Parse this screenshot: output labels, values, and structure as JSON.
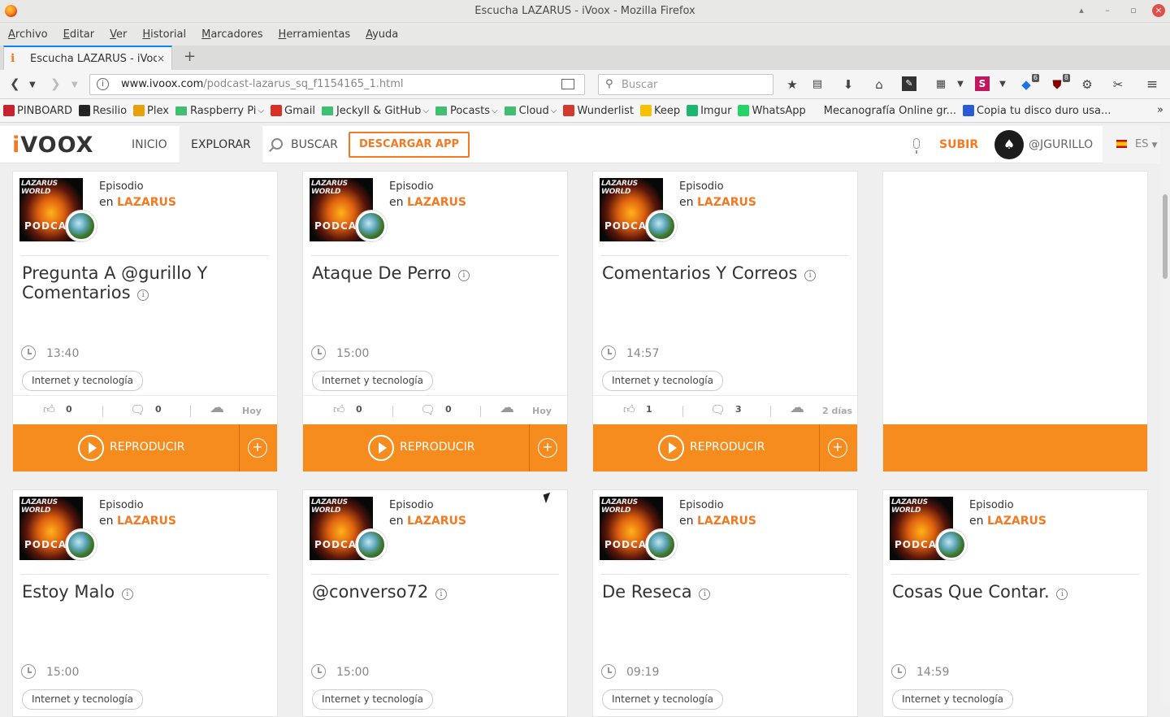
{
  "window": {
    "title": "Escucha LAZARUS - iVoox - Mozilla Firefox"
  },
  "menubar": [
    "Archivo",
    "Editar",
    "Ver",
    "Historial",
    "Marcadores",
    "Herramientas",
    "Ayuda"
  ],
  "tab": {
    "title": "Escucha LAZARUS - iVoox",
    "close": "×",
    "new_tab": "+"
  },
  "navbar": {
    "url_host": "www.ivoox.com",
    "url_path": "/podcast-lazarus_sq_f1154165_1.html",
    "search_placeholder": "Buscar",
    "badges": {
      "notifications": "6",
      "ublock": "8"
    }
  },
  "bookmarks": [
    {
      "label": "PINBOARD",
      "type": "icon",
      "color": "#c8202f"
    },
    {
      "label": "Resilio",
      "type": "icon",
      "color": "#222222"
    },
    {
      "label": "Plex",
      "type": "icon",
      "color": "#e5a00d"
    },
    {
      "label": "Raspberry Pi",
      "type": "folder",
      "chevron": true
    },
    {
      "label": "Gmail",
      "type": "icon",
      "color": "#d93025"
    },
    {
      "label": "Jeckyll & GitHub",
      "type": "folder",
      "chevron": true
    },
    {
      "label": "Pocasts",
      "type": "folder",
      "chevron": true
    },
    {
      "label": "Cloud",
      "type": "folder",
      "chevron": true
    },
    {
      "label": "Wunderlist",
      "type": "icon",
      "color": "#d23a2e"
    },
    {
      "label": "Keep",
      "type": "icon",
      "color": "#f8c100"
    },
    {
      "label": "Imgur",
      "type": "icon",
      "color": "#1bb76e"
    },
    {
      "label": "WhatsApp",
      "type": "icon",
      "color": "#25d366"
    },
    {
      "label": "Mecanografía Online gr...",
      "type": "none"
    },
    {
      "label": "Copia tu disco duro usa...",
      "type": "icon",
      "color": "#2a5bd7"
    }
  ],
  "bookmarks_more": "»",
  "site": {
    "logo_i": "i",
    "logo_rest": "VOOX",
    "nav": {
      "inicio": "INICIO",
      "explorar": "EXPLORAR",
      "buscar": "BUSCAR"
    },
    "download": "DESCARGAR APP",
    "subir": "SUBIR",
    "username": "@JGURILLO",
    "lang": "ES",
    "accent": "#f68b1e"
  },
  "thumb_text": {
    "top": "LAZARUS WORLD",
    "bottom": "PODCAS"
  },
  "episode_label": "Episodio",
  "en_label": "en",
  "podcast_name": "LAZARUS",
  "play_label": "REPRODUCIR",
  "add_label": "+",
  "episodes_row1": [
    {
      "title": "Pregunta A @gurillo Y Comentarios",
      "duration": "13:40",
      "category": "Internet y tecnología",
      "likes": "0",
      "comments": "0",
      "when": "Hoy"
    },
    {
      "title": "Ataque De Perro",
      "duration": "15:00",
      "category": "Internet y tecnología",
      "likes": "0",
      "comments": "0",
      "when": "Hoy"
    },
    {
      "title": "Comentarios Y Correos",
      "duration": "14:57",
      "category": "Internet y tecnología",
      "likes": "1",
      "comments": "3",
      "when": "2 días"
    }
  ],
  "episodes_row2": [
    {
      "title": "Estoy Malo",
      "duration": "15:00",
      "category": "Internet y tecnología"
    },
    {
      "title": "@converso72",
      "duration": "15:00",
      "category": "Internet y tecnología"
    },
    {
      "title": "De Reseca",
      "duration": "09:19",
      "category": "Internet y tecnología"
    },
    {
      "title": "Cosas Que Contar.",
      "duration": "14:59",
      "category": "Internet y tecnología"
    }
  ]
}
